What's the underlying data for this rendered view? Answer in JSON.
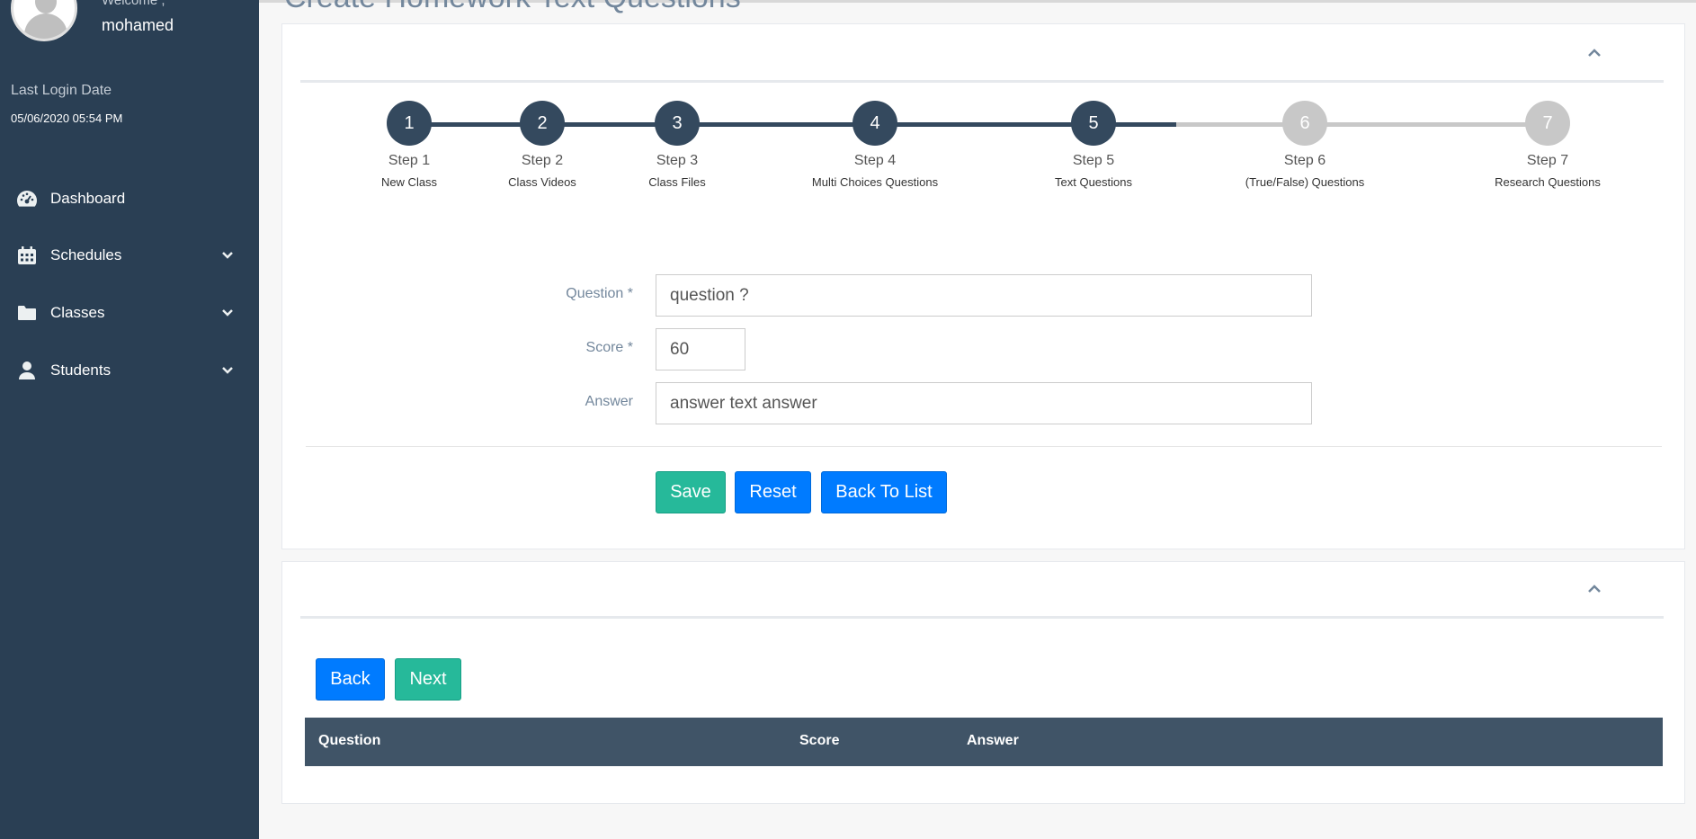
{
  "user": {
    "welcome": "Welcome ,",
    "name": "mohamed",
    "last_login_label": "Last Login Date",
    "last_login_date": "05/06/2020 05:54 PM"
  },
  "sidebar": {
    "items": [
      {
        "label": "Dashboard",
        "icon": "dashboard-icon",
        "has_submenu": false
      },
      {
        "label": "Schedules",
        "icon": "calendar-icon",
        "has_submenu": true
      },
      {
        "label": "Classes",
        "icon": "folder-icon",
        "has_submenu": true
      },
      {
        "label": "Students",
        "icon": "user-icon",
        "has_submenu": true
      }
    ]
  },
  "page": {
    "title": "Create Homework Text Questions"
  },
  "wizard": {
    "current_step": 5,
    "steps": [
      {
        "number": "1",
        "title": "Step 1",
        "subtitle": "New Class"
      },
      {
        "number": "2",
        "title": "Step 2",
        "subtitle": "Class Videos"
      },
      {
        "number": "3",
        "title": "Step 3",
        "subtitle": "Class Files"
      },
      {
        "number": "4",
        "title": "Step 4",
        "subtitle": "Multi Choices Questions"
      },
      {
        "number": "5",
        "title": "Step 5",
        "subtitle": "Text Questions"
      },
      {
        "number": "6",
        "title": "Step 6",
        "subtitle": "(True/False) Questions"
      },
      {
        "number": "7",
        "title": "Step 7",
        "subtitle": "Research Questions"
      }
    ]
  },
  "form": {
    "question_label": "Question *",
    "question_value": "question ?",
    "score_label": "Score *",
    "score_value": "60",
    "answer_label": "Answer",
    "answer_value": "answer text answer "
  },
  "buttons": {
    "save": "Save",
    "reset": "Reset",
    "back_to_list": "Back To List",
    "back": "Back",
    "next": "Next"
  },
  "table": {
    "columns": [
      "Question",
      "Score",
      "Answer"
    ]
  },
  "colors": {
    "sidebar": "#2a3f54",
    "step_done": "#34495e",
    "step_todo": "#c8c8c8",
    "green": "#26b99a",
    "blue": "#007bff",
    "table_header": "#405467"
  }
}
